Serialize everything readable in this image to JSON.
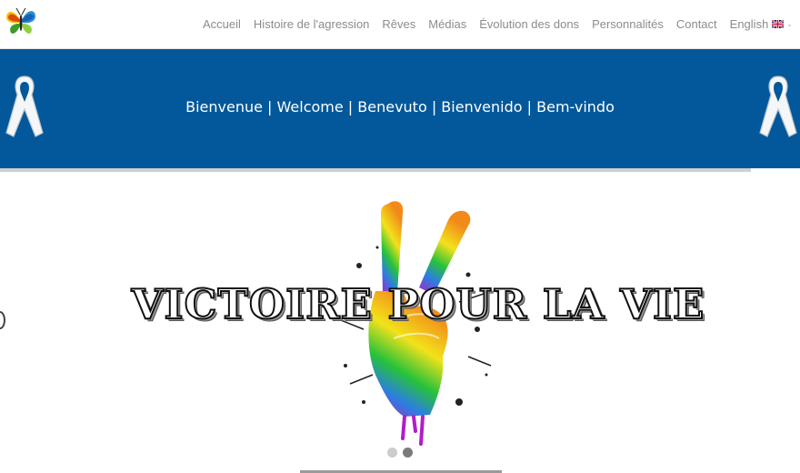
{
  "header": {
    "logo_icon": "butterfly-icon",
    "nav": [
      {
        "label": "Accueil"
      },
      {
        "label": "Histoire de l'agression"
      },
      {
        "label": "Rêves"
      },
      {
        "label": "Médias"
      },
      {
        "label": "Évolution des dons"
      },
      {
        "label": "Personnalités"
      },
      {
        "label": "Contact"
      }
    ],
    "language": {
      "label": "English",
      "flag_icon": "uk-flag-icon",
      "caret_icon": "chevron-down-icon"
    }
  },
  "banner": {
    "text": "Bienvenue | Welcome | Benevuto | Bienvenido | Bem-vindo",
    "background": "#02589a",
    "ribbon_icon": "white-ribbon-icon"
  },
  "slider": {
    "title": "VICTOIRE POUR LA VIE",
    "image_icon": "rainbow-victory-hand-icon",
    "slides_count": 2,
    "active_slide": 2
  },
  "colors": {
    "nav_text": "#8c8c8c",
    "banner": "#02589a",
    "banner_text": "#ffffff"
  }
}
